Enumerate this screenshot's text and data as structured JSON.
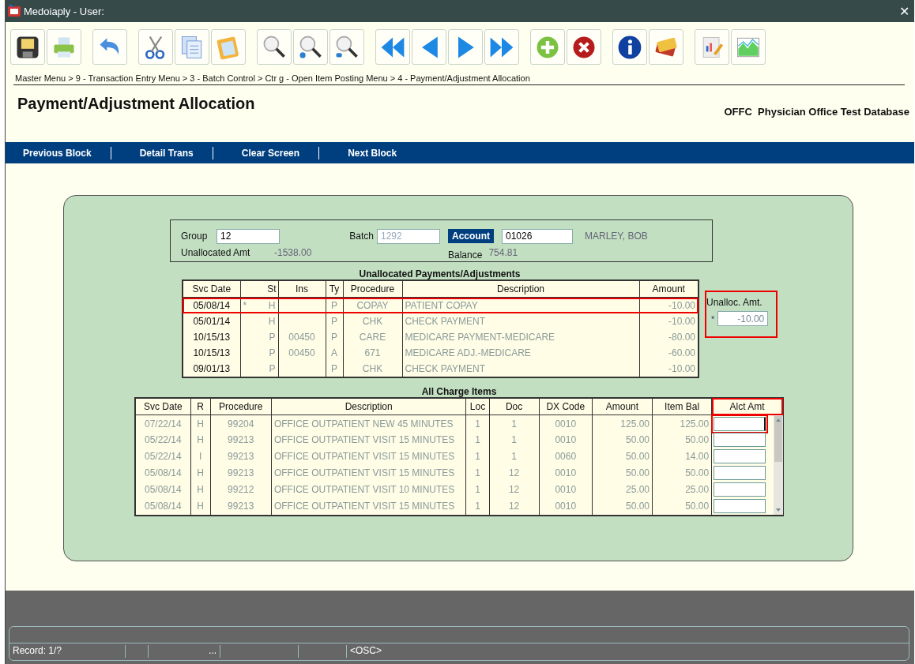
{
  "window": {
    "title": "Medoiaply - User:",
    "close": "✕"
  },
  "toolbar": [
    [
      {
        "kind": "save"
      },
      {
        "kind": "print"
      }
    ],
    [
      {
        "kind": "undo"
      }
    ],
    [
      {
        "kind": "cut"
      },
      {
        "kind": "copy"
      },
      {
        "kind": "paste"
      }
    ],
    [
      {
        "kind": "search"
      },
      {
        "kind": "zoom-in"
      },
      {
        "kind": "zoom-out"
      }
    ],
    [
      {
        "kind": "first"
      },
      {
        "kind": "prev"
      },
      {
        "kind": "next"
      },
      {
        "kind": "last"
      }
    ],
    [
      {
        "kind": "add"
      },
      {
        "kind": "delete"
      }
    ],
    [
      {
        "kind": "info"
      },
      {
        "kind": "cards"
      }
    ],
    [
      {
        "kind": "report"
      },
      {
        "kind": "chart"
      }
    ]
  ],
  "breadcrumb": "Master Menu > 9 - Transaction Entry Menu > 3 - Batch Control > Ctr g - Open Item Posting Menu > 4 - Payment/Adjustment Allocation",
  "page_title": "Payment/Adjustment Allocation",
  "database": "OFFC  Physician Office Test Database",
  "nav": [
    "Previous Block",
    "Detail Trans",
    "Clear Screen",
    "Next Block"
  ],
  "header": {
    "group_label": "Group",
    "group": "12",
    "batch_label": "Batch",
    "batch": "1292",
    "account_label": "Account",
    "account": "01026",
    "patient": "MARLEY, BOB",
    "unallocated_label": "Unallocated Amt",
    "unallocated": "-1538.00",
    "balance_label": "Balance",
    "balance": "754.81"
  },
  "unallocated": {
    "title": "Unallocated Payments/Adjustments",
    "columns": [
      "Svc Date",
      "St",
      "Ins",
      "Ty",
      "Procedure",
      "Description",
      "Amount"
    ],
    "rows": [
      {
        "selected": true,
        "mark": "*",
        "cells": [
          "05/08/14",
          "H",
          "",
          "P",
          "COPAY",
          "PATIENT COPAY",
          "-10.00"
        ]
      },
      {
        "selected": false,
        "cells": [
          "05/01/14",
          "H",
          "",
          "P",
          "CHK",
          "CHECK PAYMENT",
          "-10.00"
        ]
      },
      {
        "selected": false,
        "cells": [
          "10/15/13",
          "P",
          "00450",
          "P",
          "CARE",
          "MEDICARE PAYMENT-MEDICARE",
          "-80.00"
        ]
      },
      {
        "selected": false,
        "cells": [
          "10/15/13",
          "P",
          "00450",
          "A",
          "671",
          "MEDICARE ADJ.-MEDICARE",
          "-60.00"
        ]
      },
      {
        "selected": false,
        "cells": [
          "09/01/13",
          "P",
          "",
          "P",
          "CHK",
          "CHECK PAYMENT",
          "-10.00"
        ]
      }
    ]
  },
  "unalloc_amount": {
    "label": "Unalloc. Amt.",
    "mark": "*",
    "value": "-10.00",
    "highlighted": true
  },
  "charges": {
    "title": "All Charge Items",
    "columns": [
      "Svc Date",
      "R",
      "Procedure",
      "Description",
      "Loc",
      "Doc",
      "DX Code",
      "Amount",
      "Item Bal",
      "Alct Amt"
    ],
    "rows": [
      {
        "focused": true,
        "cells": [
          "07/22/14",
          "H",
          "99204",
          "OFFICE OUTPATIENT NEW 45 MINUTES",
          "1",
          "1",
          "0010",
          "125.00",
          "125.00"
        ]
      },
      {
        "focused": false,
        "cells": [
          "05/22/14",
          "H",
          "99213",
          "OFFICE OUTPATIENT VISIT 15 MINUTES",
          "1",
          "1",
          "0010",
          "50.00",
          "50.00"
        ]
      },
      {
        "focused": false,
        "cells": [
          "05/22/14",
          "I",
          "99213",
          "OFFICE OUTPATIENT VISIT 15 MINUTES",
          "1",
          "1",
          "0060",
          "50.00",
          "14.00"
        ]
      },
      {
        "focused": false,
        "cells": [
          "05/08/14",
          "H",
          "99213",
          "OFFICE OUTPATIENT VISIT 15 MINUTES",
          "1",
          "12",
          "0010",
          "50.00",
          "50.00"
        ]
      },
      {
        "focused": false,
        "cells": [
          "05/08/14",
          "H",
          "99212",
          "OFFICE OUTPATIENT VISIT 10 MINUTES",
          "1",
          "12",
          "0010",
          "25.00",
          "25.00"
        ]
      },
      {
        "focused": false,
        "cells": [
          "05/08/14",
          "H",
          "99213",
          "OFFICE OUTPATIENT VISIT 15 MINUTES",
          "1",
          "12",
          "0010",
          "50.00",
          "50.00"
        ]
      }
    ]
  },
  "status_bar": {
    "record": "Record: 1/?",
    "cell_3": "...",
    "mode": "<OSC>"
  }
}
